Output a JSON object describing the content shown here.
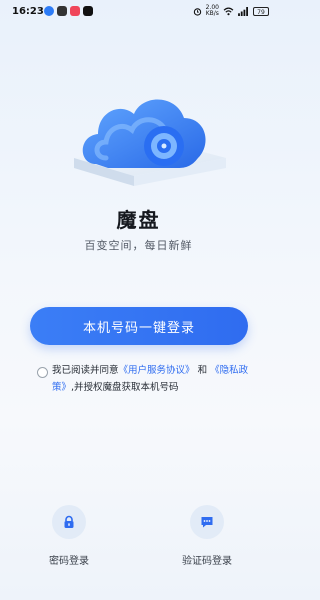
{
  "status_bar": {
    "time": "16:23",
    "net_speed_value": "2.00",
    "net_speed_unit": "KB/s",
    "battery": "79"
  },
  "app": {
    "title": "魔盘",
    "slogan": "百变空间，每日新鲜"
  },
  "login": {
    "one_key_label": "本机号码一键登录"
  },
  "agreement": {
    "prefix": "我已阅读并同意",
    "user_agreement": "《用户服务协议》",
    "and": "和",
    "privacy_policy": "《隐私政策》",
    "suffix": ",并授权魔盘获取本机号码"
  },
  "alt_login": {
    "password_label": "密码登录",
    "sms_label": "验证码登录"
  },
  "colors": {
    "accent": "#2f6cf0",
    "icon_bg": "#e2ebf7"
  },
  "icons": {
    "password": "lock-icon",
    "sms": "message-icon",
    "hero": "cloud-logo-icon"
  }
}
